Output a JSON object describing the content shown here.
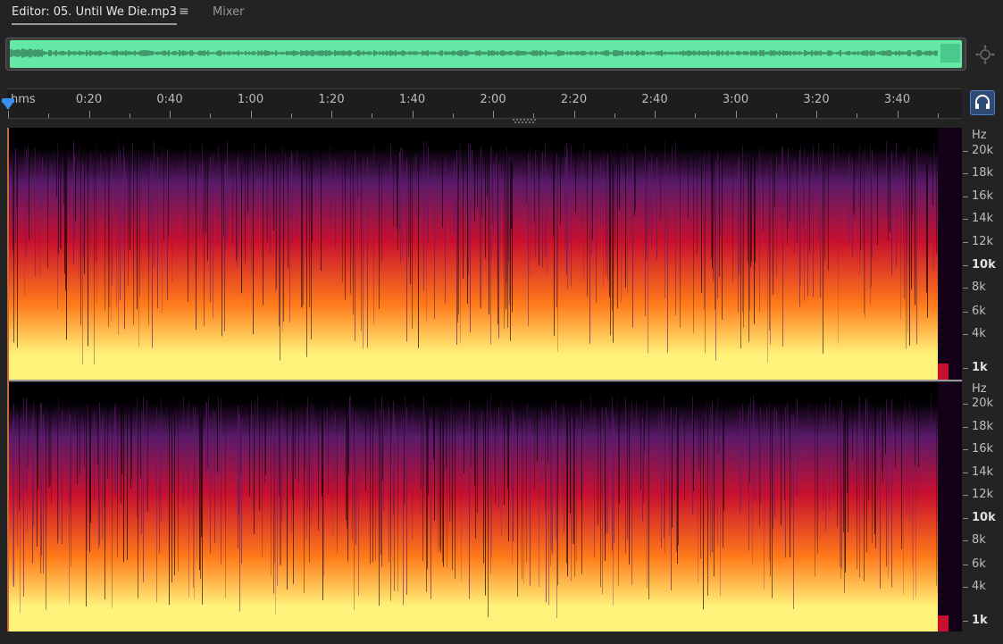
{
  "tabs": {
    "editor_label": "Editor: 05. Until We Die.mp3",
    "menu_glyph": "≡",
    "mixer_label": "Mixer"
  },
  "ruler": {
    "unit_label": "hms",
    "time_labels": [
      "0:20",
      "0:40",
      "1:00",
      "1:20",
      "1:40",
      "2:00",
      "2:20",
      "2:40",
      "3:00",
      "3:20",
      "3:40"
    ],
    "time_seconds": [
      20,
      40,
      60,
      80,
      100,
      120,
      140,
      160,
      180,
      200,
      220
    ],
    "minor_tick_seconds": 10,
    "total_seconds": 235
  },
  "overview": {
    "color": "#64e8a5"
  },
  "spectral": {
    "colors": {
      "high": "#fff27a",
      "mid": "#ff7a1a",
      "low": "#c8102e",
      "dim": "#5b1a6a",
      "background": "#000000"
    },
    "channels": [
      {
        "name": "channel-1",
        "scale_title": "Hz",
        "scale_labels": [
          {
            "text": "20k",
            "bold": false
          },
          {
            "text": "18k",
            "bold": false
          },
          {
            "text": "16k",
            "bold": false
          },
          {
            "text": "14k",
            "bold": false
          },
          {
            "text": "12k",
            "bold": false
          },
          {
            "text": "10k",
            "bold": true
          },
          {
            "text": "8k",
            "bold": false
          },
          {
            "text": "6k",
            "bold": false
          },
          {
            "text": "4k",
            "bold": false
          },
          {
            "text": "1k",
            "bold": true
          }
        ]
      },
      {
        "name": "channel-2",
        "scale_title": "Hz",
        "scale_labels": [
          {
            "text": "20k",
            "bold": false
          },
          {
            "text": "18k",
            "bold": false
          },
          {
            "text": "16k",
            "bold": false
          },
          {
            "text": "14k",
            "bold": false
          },
          {
            "text": "12k",
            "bold": false
          },
          {
            "text": "10k",
            "bold": true
          },
          {
            "text": "8k",
            "bold": false
          },
          {
            "text": "6k",
            "bold": false
          },
          {
            "text": "4k",
            "bold": false
          },
          {
            "text": "1k",
            "bold": true
          }
        ]
      }
    ]
  },
  "icons": {
    "zoom": "zoom-navigator-icon",
    "monitor": "headphones-icon"
  }
}
